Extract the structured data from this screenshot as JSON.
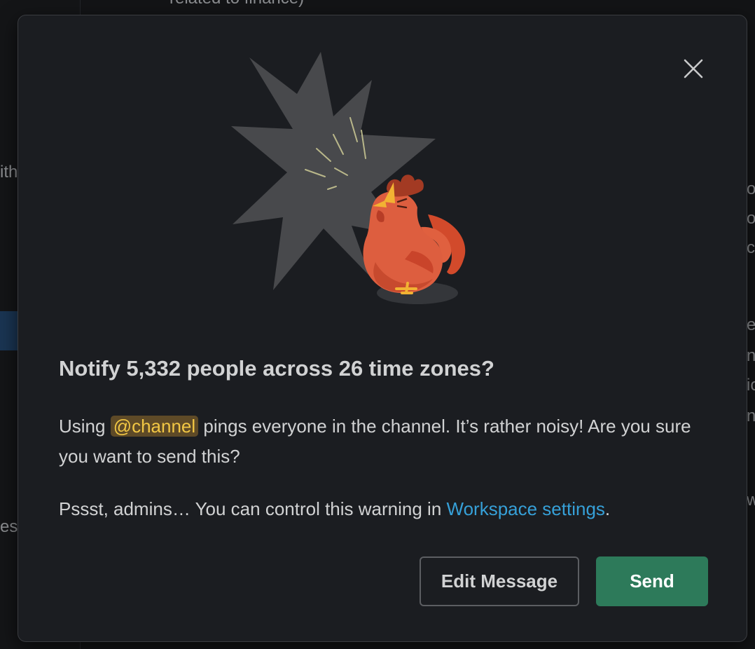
{
  "background": {
    "top_text": "related to finance)",
    "left_text_1": "ith",
    "left_text_2": "es",
    "right_fragments": [
      "o",
      "o",
      "co",
      "e",
      "n",
      "io",
      "no",
      "w"
    ]
  },
  "modal": {
    "close_label": "Close",
    "title": "Notify 5,332 people across 26 time zones?",
    "body_prefix": "Using ",
    "mention": "@channel",
    "body_suffix": " pings everyone in the channel. It’s rather noisy! Are you sure you want to send this?",
    "admin_prefix": "Pssst, admins… You can control this warning in ",
    "admin_link": "Workspace settings",
    "admin_suffix": ".",
    "edit_button": "Edit Message",
    "send_button": "Send"
  },
  "colors": {
    "modal_bg": "#1b1d21",
    "text": "#d1d2d3",
    "link": "#36a0d8",
    "mention_bg": "#5e4a27",
    "mention_text": "#f2c744",
    "send_bg": "#2d7a5a"
  },
  "icons": {
    "close": "close-icon",
    "illustration": "rooster-illustration"
  }
}
